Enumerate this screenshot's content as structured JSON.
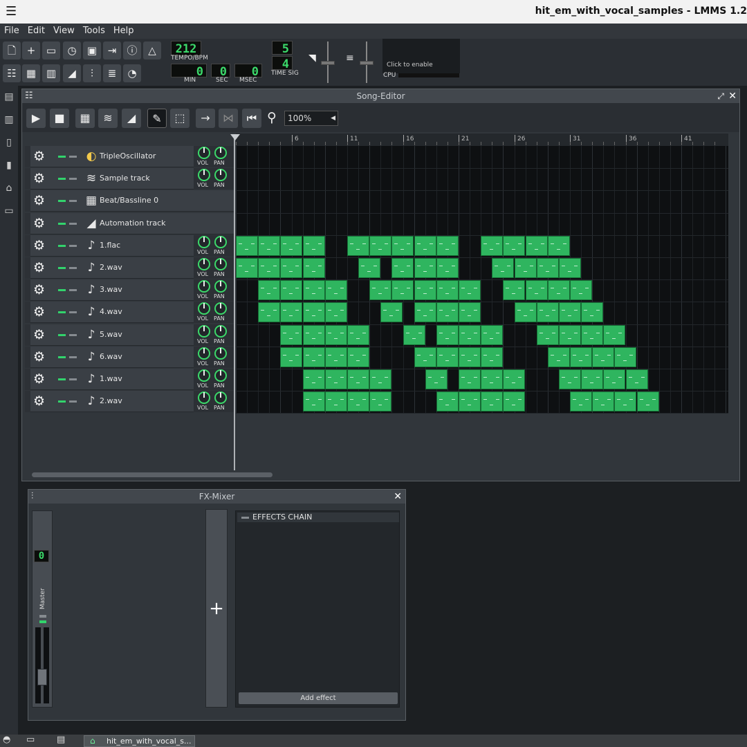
{
  "window": {
    "title": "hit_em_with_vocal_samples - LMMS 1.2"
  },
  "menu": [
    "File",
    "Edit",
    "View",
    "Tools",
    "Help"
  ],
  "toolbar": {
    "tempo": "212",
    "tempo_label": "TEMPO/BPM",
    "time_min": "0",
    "time_sec": "0",
    "time_msec": "0",
    "min_label": "MIN",
    "sec_label": "SEC",
    "msec_label": "MSEC",
    "timesig_num": "5",
    "timesig_den": "4",
    "timesig_label": "TIME SIG",
    "cpu_hint": "Click to enable",
    "cpu_label": "CPU"
  },
  "song_editor": {
    "title": "Song-Editor",
    "zoom": "100%",
    "ruler": [
      "6",
      "11",
      "16",
      "21",
      "26",
      "31",
      "36",
      "41"
    ],
    "knob_vol": "VOL",
    "knob_pan": "PAN",
    "tracks": [
      {
        "name": "TripleOscillator",
        "type": "instrument",
        "icon": "triple-oscillator-icon",
        "knobs": true
      },
      {
        "name": "Sample track",
        "type": "sample",
        "icon": "waveform-icon",
        "knobs": true
      },
      {
        "name": "Beat/Bassline 0",
        "type": "beat",
        "icon": "beat-grid-icon",
        "knobs": false
      },
      {
        "name": "Automation track",
        "type": "automation",
        "icon": "automation-ramp-icon",
        "knobs": false
      },
      {
        "name": "1.flac",
        "type": "sample",
        "icon": "note-icon",
        "knobs": true
      },
      {
        "name": "2.wav",
        "type": "sample",
        "icon": "note-icon",
        "knobs": true
      },
      {
        "name": "3.wav",
        "type": "sample",
        "icon": "note-icon",
        "knobs": true
      },
      {
        "name": "4.wav",
        "type": "sample",
        "icon": "note-icon",
        "knobs": true
      },
      {
        "name": "5.wav",
        "type": "sample",
        "icon": "note-icon",
        "knobs": true
      },
      {
        "name": "6.wav",
        "type": "sample",
        "icon": "note-icon",
        "knobs": true
      },
      {
        "name": "1.wav",
        "type": "sample",
        "icon": "note-icon",
        "knobs": true
      },
      {
        "name": "2.wav",
        "type": "sample",
        "icon": "note-icon",
        "knobs": true
      }
    ],
    "clips": [
      {
        "track": 4,
        "bars": [
          [
            1,
            9
          ],
          [
            11,
            21
          ],
          [
            23,
            31
          ]
        ]
      },
      {
        "track": 5,
        "bars": [
          [
            1,
            9
          ],
          [
            12,
            14
          ],
          [
            15,
            21
          ],
          [
            24,
            32
          ]
        ]
      },
      {
        "track": 6,
        "bars": [
          [
            3,
            11
          ],
          [
            13,
            23
          ],
          [
            25,
            33
          ]
        ]
      },
      {
        "track": 7,
        "bars": [
          [
            3,
            11
          ],
          [
            14,
            16
          ],
          [
            17,
            23
          ],
          [
            26,
            34
          ]
        ]
      },
      {
        "track": 8,
        "bars": [
          [
            5,
            13
          ],
          [
            16,
            18
          ],
          [
            19,
            25
          ],
          [
            28,
            36
          ]
        ]
      },
      {
        "track": 9,
        "bars": [
          [
            5,
            13
          ],
          [
            17,
            25
          ],
          [
            29,
            37
          ]
        ]
      },
      {
        "track": 10,
        "bars": [
          [
            7,
            15
          ],
          [
            18,
            20
          ],
          [
            21,
            27
          ],
          [
            30,
            38
          ]
        ]
      },
      {
        "track": 11,
        "bars": [
          [
            7,
            15
          ],
          [
            19,
            27
          ],
          [
            31,
            39
          ]
        ]
      }
    ],
    "clip_color": "#2fb55f"
  },
  "fx_mixer": {
    "title": "FX-Mixer",
    "master_label": "Master",
    "master_channel": "0",
    "effects_chain": "EFFECTS CHAIN",
    "add_effect": "Add effect"
  },
  "taskbar": {
    "task": "hit_em_with_vocal_s..."
  }
}
